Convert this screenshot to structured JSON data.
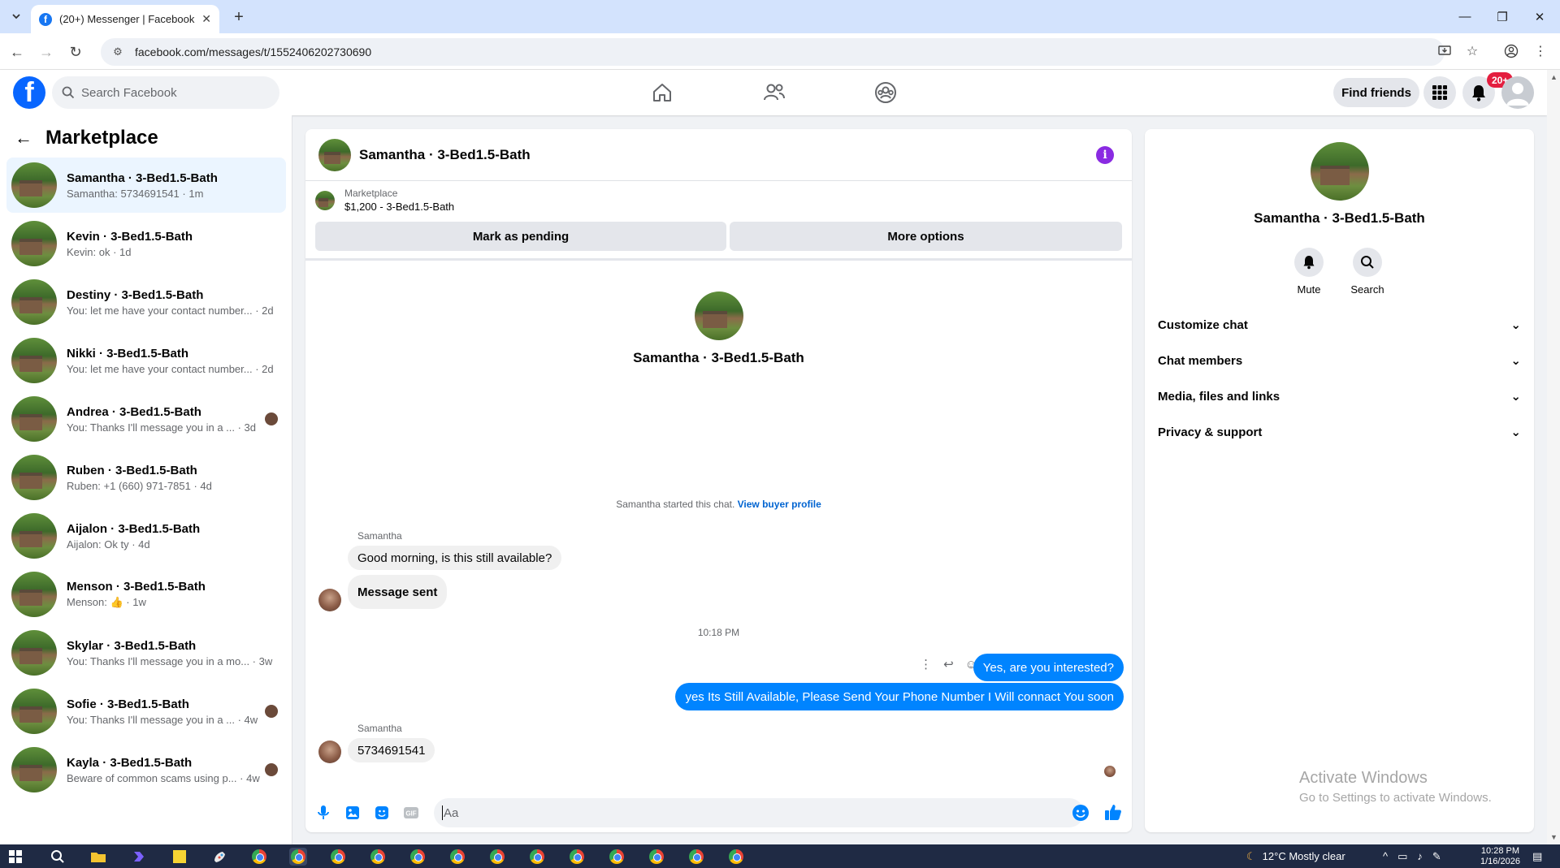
{
  "browser": {
    "tab_title": "(20+) Messenger | Facebook",
    "tab_favicon": "f",
    "url": "facebook.com/messages/t/1552406202730690",
    "window_controls": [
      "—",
      "❐",
      "✕"
    ]
  },
  "header": {
    "search_placeholder": "Search Facebook",
    "find_friends_label": "Find friends",
    "notification_count": "20+",
    "logo_letter": "f"
  },
  "sidebar": {
    "title": "Marketplace",
    "chats": [
      {
        "name": "Samantha · 3-Bed1.5-Bath",
        "preview": "Samantha: 5734691541 · 1m",
        "active": true
      },
      {
        "name": "Kevin · 3-Bed1.5-Bath",
        "preview": "Kevin: ok · 1d"
      },
      {
        "name": "Destiny · 3-Bed1.5-Bath",
        "preview": "You: let me have your contact number... · 2d"
      },
      {
        "name": "Nikki · 3-Bed1.5-Bath",
        "preview": "You: let me have your contact number... · 2d"
      },
      {
        "name": "Andrea · 3-Bed1.5-Bath",
        "preview": "You: Thanks I'll message you in a ... · 3d",
        "seen": true
      },
      {
        "name": "Ruben · 3-Bed1.5-Bath",
        "preview": "Ruben: +1 (660) 971-7851 · 4d"
      },
      {
        "name": "Aijalon · 3-Bed1.5-Bath",
        "preview": "Aijalon: Ok ty · 4d"
      },
      {
        "name": "Menson · 3-Bed1.5-Bath",
        "preview": "Menson: 👍 · 1w"
      },
      {
        "name": "Skylar · 3-Bed1.5-Bath",
        "preview": "You: Thanks I'll message you in a mo... · 3w"
      },
      {
        "name": "Sofie · 3-Bed1.5-Bath",
        "preview": "You: Thanks I'll message you in a ... · 4w",
        "seen": true
      },
      {
        "name": "Kayla · 3-Bed1.5-Bath",
        "preview": "Beware of common scams using p... · 4w",
        "seen": true
      }
    ]
  },
  "conversation": {
    "title": "Samantha · 3-Bed1.5-Bath",
    "marketplace_label": "Marketplace",
    "listing": "$1,200 - 3-Bed1.5-Bath",
    "mark_pending_label": "Mark as pending",
    "more_options_label": "More options",
    "profile_name": "Samantha · 3-Bed1.5-Bath",
    "started_text": "Samantha started this chat.",
    "view_profile_link": "View buyer profile",
    "sender_name_1": "Samantha",
    "msg_1": "Good morning, is this still available?",
    "msg_2": "Message sent",
    "time_separator": "10:18 PM",
    "out_1": "Yes, are you interested?",
    "out_2": "yes Its Still Available, Please Send Your Phone Number I Will connact You  soon",
    "sender_name_2": "Samantha",
    "msg_3": "5734691541",
    "composer_placeholder": "Aa"
  },
  "info_panel": {
    "name": "Samantha · 3-Bed1.5-Bath",
    "mute_label": "Mute",
    "search_label": "Search",
    "sections": [
      "Customize chat",
      "Chat members",
      "Media, files and links",
      "Privacy & support"
    ]
  },
  "watermark": {
    "line1": "Activate Windows",
    "line2": "Go to Settings to activate Windows."
  },
  "taskbar": {
    "weather": "12°C  Mostly clear",
    "time": "10:28 PM",
    "date": "1/16/2026"
  },
  "colors": {
    "accent": "#0084ff",
    "fb_blue": "#0866ff",
    "badge_red": "#e41e3f",
    "info_purple": "#8a2be2"
  }
}
